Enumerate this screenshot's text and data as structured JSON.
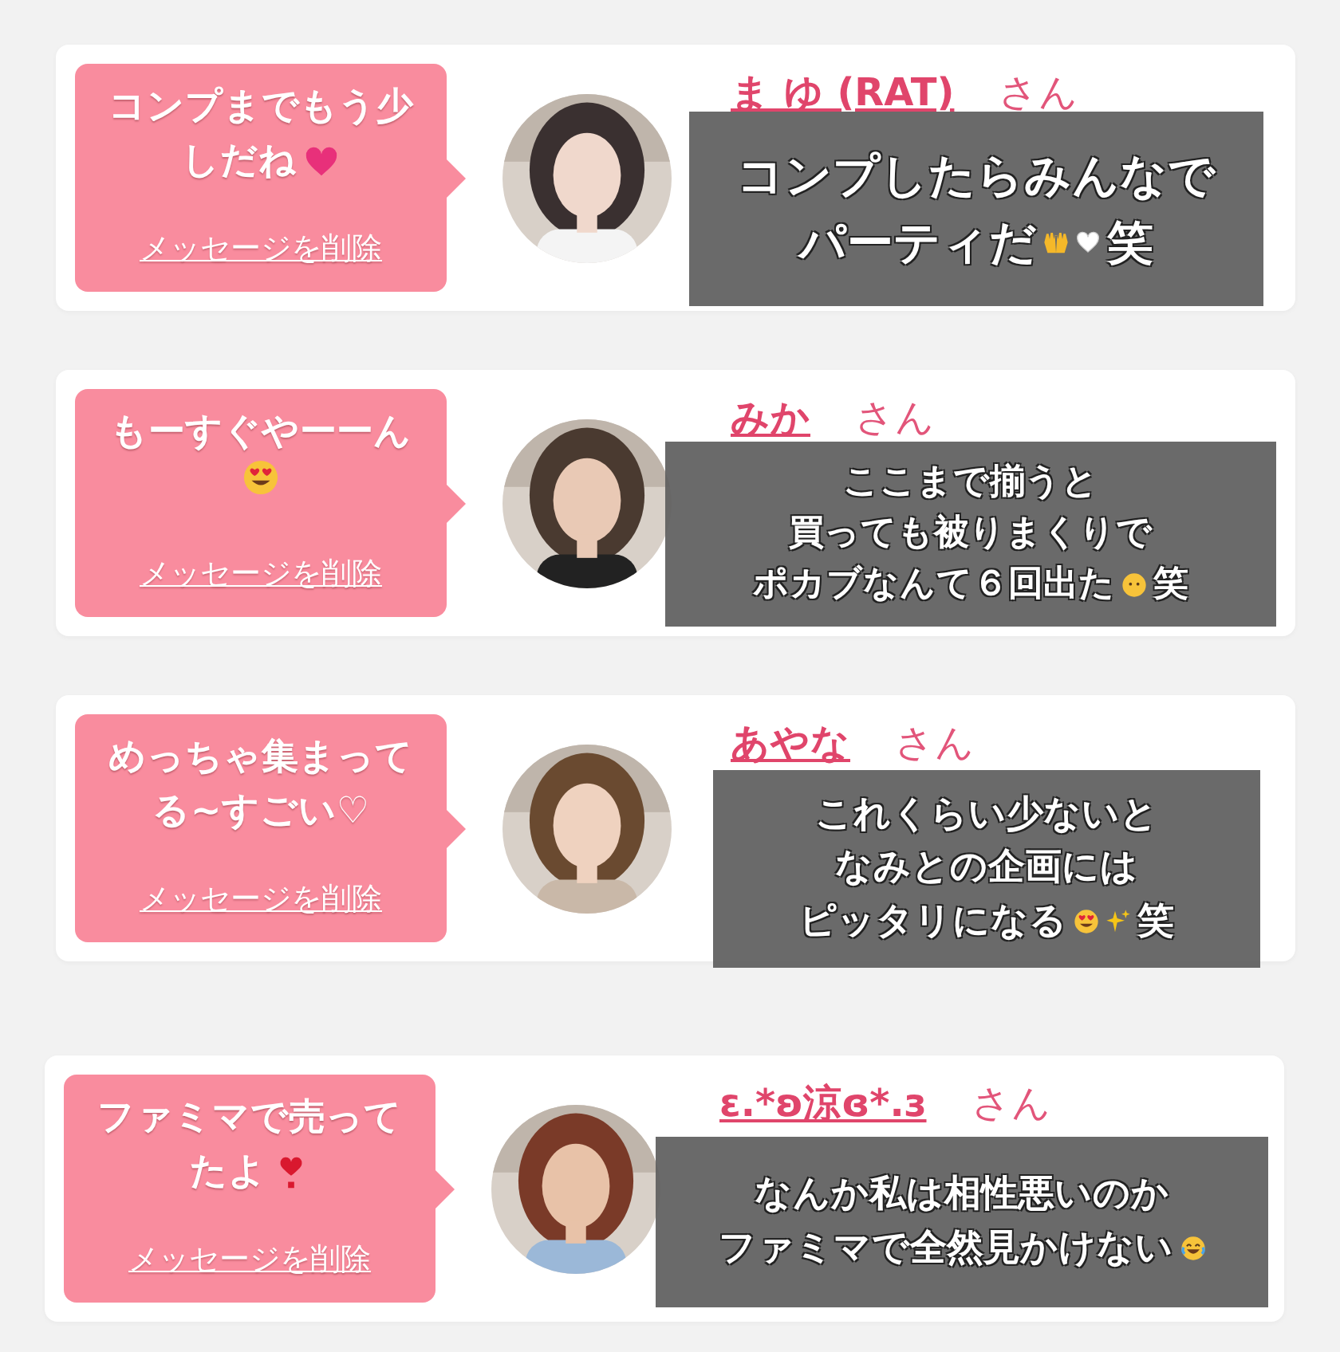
{
  "cards": [
    {
      "message": [
        "コンプまでもう少",
        "しだね"
      ],
      "delete_link": "メッセージを削除",
      "name": "ま ゆ (RAT)",
      "honorific": "さん",
      "caption": [
        [
          "コンプしたらみんなで"
        ],
        [
          "パーティだ",
          "笑"
        ]
      ]
    },
    {
      "message": [
        "もーすぐやーーん"
      ],
      "delete_link": "メッセージを削除",
      "name": "みか",
      "honorific": "さん",
      "caption": [
        [
          "ここまで揃うと"
        ],
        [
          "買っても被りまくりで"
        ],
        [
          "ポカブなんて６回出た",
          "笑"
        ]
      ]
    },
    {
      "message": [
        "めっちゃ集まって",
        "る~すごい♡"
      ],
      "delete_link": "メッセージを削除",
      "name": "あやな",
      "honorific": "さん",
      "caption": [
        [
          "これくらい少ないと"
        ],
        [
          "なみとの企画には"
        ],
        [
          "ピッタリになる",
          "笑"
        ]
      ]
    },
    {
      "message": [
        "ファミマで売って",
        "たよ"
      ],
      "delete_link": "メッセージを削除",
      "name": "ε.*ʚ涼ɞ*.з",
      "honorific": "さん",
      "caption": [
        [
          "なんか私は相性悪いのか"
        ],
        [
          "ファミマで全然見かけない"
        ]
      ]
    }
  ]
}
